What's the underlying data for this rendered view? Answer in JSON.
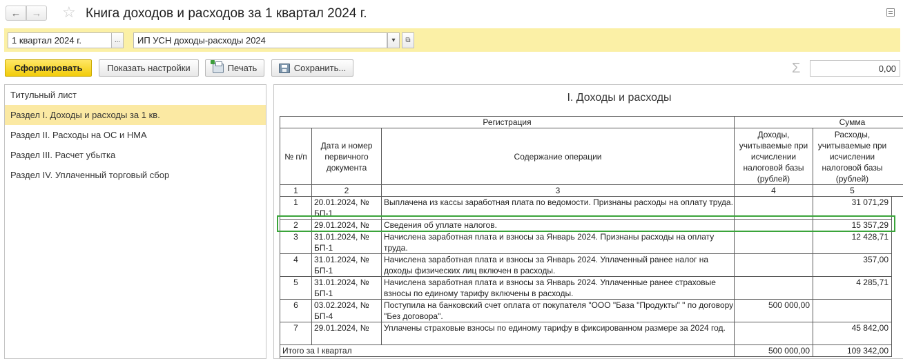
{
  "window": {
    "title": "Книга доходов и расходов за 1 квартал 2024 г.",
    "back_icon": "arrow-left",
    "forward_icon": "arrow-right",
    "favorite_icon": "star",
    "menu_icon": "list"
  },
  "params": {
    "period": "1 квартал 2024 г.",
    "period_select": "...",
    "organization": "ИП УСН доходы-расходы 2024",
    "org_dropdown": "▾",
    "org_open": "⧉"
  },
  "toolbar": {
    "generate": "Сформировать",
    "settings": "Показать настройки",
    "print": "Печать",
    "save": "Сохранить...",
    "sigma": "Σ",
    "sum_value": "0,00"
  },
  "sections": [
    {
      "label": "Титульный лист"
    },
    {
      "label": "Раздел I. Доходы и расходы за 1 кв."
    },
    {
      "label": "Раздел II. Расходы на ОС и НМА"
    },
    {
      "label": "Раздел III. Расчет убытка"
    },
    {
      "label": "Раздел IV. Уплаченный торговый сбор"
    }
  ],
  "report": {
    "title": "I. Доходы и расходы",
    "header": {
      "registration": "Регистрация",
      "sum": "Сумма",
      "num": "№ п/п",
      "date": "Дата и номер первичного документа",
      "content": "Содержание операции",
      "income": "Доходы, учитываемые при исчислении налоговой базы (рублей)",
      "expense": "Расходы, учитываемые при исчислении налоговой базы (рублей)",
      "col_nums": [
        "1",
        "2",
        "3",
        "4",
        "5"
      ]
    },
    "rows": [
      {
        "num": "1",
        "date": "20.01.2024, № БП-1",
        "content": "Выплачена из кассы заработная плата по ведомости. Признаны расходы на оплату труда.",
        "income": "",
        "expense": "31 071,29"
      },
      {
        "num": "2",
        "date": "29.01.2024, №",
        "content": "Сведения об уплате налогов.",
        "income": "",
        "expense": "15 357,29"
      },
      {
        "num": "3",
        "date": "31.01.2024, № БП-1",
        "content": "Начислена заработная плата и взносы за Январь 2024. Признаны расходы на оплату труда.",
        "income": "",
        "expense": "12 428,71"
      },
      {
        "num": "4",
        "date": "31.01.2024, № БП-1",
        "content": "Начислена заработная плата и взносы за Январь 2024. Уплаченный ранее налог на доходы физических лиц включен в расходы.",
        "income": "",
        "expense": "357,00"
      },
      {
        "num": "5",
        "date": "31.01.2024, № БП-1",
        "content": "Начислена заработная плата и взносы за Январь 2024. Уплаченные ранее страховые взносы по единому тарифу включены в расходы.",
        "income": "",
        "expense": "4 285,71"
      },
      {
        "num": "6",
        "date": "03.02.2024, № БП-4",
        "content": "Поступила на банковский счет оплата от покупателя \"ООО \"База \"Продукты\" \" по договору \"Без договора\".",
        "income": "500 000,00",
        "expense": ""
      },
      {
        "num": "7",
        "date": "29.01.2024, №",
        "content": "Уплачены страховые взносы по единому тарифу в фиксированном размере за 2024 год.",
        "income": "",
        "expense": "45 842,00"
      }
    ],
    "total": {
      "label": "Итого за I квартал",
      "income": "500 000,00",
      "expense": "109 342,00"
    }
  },
  "colors": {
    "params_band": "#fbf0a6",
    "active_section": "#fbe9a3",
    "primary_button": "#f2cc0a",
    "highlight_border": "#3aa43a"
  }
}
